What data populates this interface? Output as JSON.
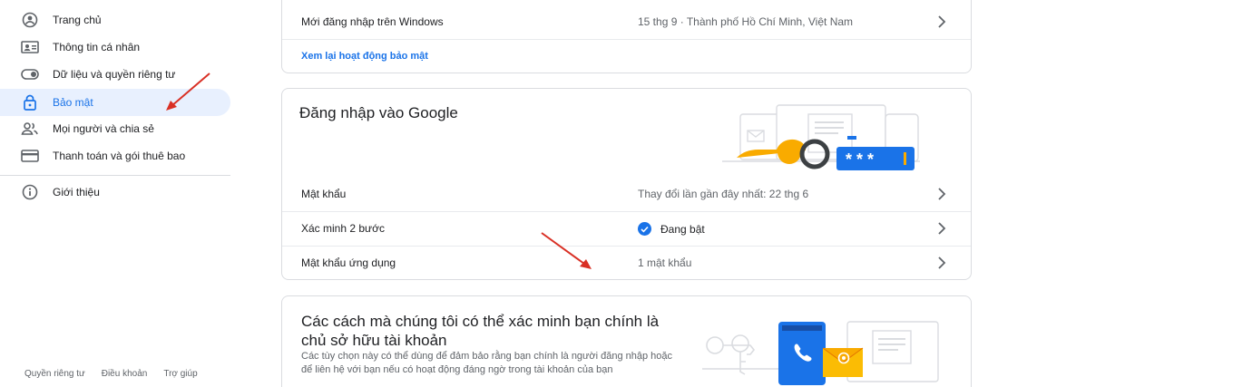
{
  "sidebar": {
    "items": [
      {
        "label": "Trang chủ",
        "icon": "home-icon"
      },
      {
        "label": "Thông tin cá nhân",
        "icon": "id-card-icon"
      },
      {
        "label": "Dữ liệu và quyền riêng tư",
        "icon": "toggle-icon"
      },
      {
        "label": "Bảo mật",
        "icon": "lock-icon",
        "active": true
      },
      {
        "label": "Mọi người và chia sẻ",
        "icon": "people-icon"
      },
      {
        "label": "Thanh toán và gói thuê bao",
        "icon": "credit-card-icon"
      },
      {
        "label": "Giới thiệu",
        "icon": "info-icon"
      }
    ],
    "footer": {
      "privacy": "Quyền riêng tư",
      "terms": "Điều khoản",
      "help": "Trợ giúp"
    }
  },
  "recent_activity": {
    "row_label": "Mới đăng nhập trên Windows",
    "row_value": "15 thg 9 · Thành phố Hồ Chí Minh, Việt Nam",
    "review_link": "Xem lại hoạt động bảo mật"
  },
  "signin": {
    "title": "Đăng nhập vào Google",
    "rows": [
      {
        "label": "Mật khẩu",
        "value": "Thay đổi lần gần đây nhất: 22 thg 6"
      },
      {
        "label": "Xác minh 2 bước",
        "value": "Đang bật",
        "status": "on"
      },
      {
        "label": "Mật khẩu ứng dụng",
        "value": "1 mật khẩu"
      }
    ],
    "password_mask": "* * *"
  },
  "verify": {
    "title": "Các cách mà chúng tôi có thể xác minh bạn chính là chủ sở hữu tài khoản",
    "description": "Các tùy chọn này có thể dùng để đảm bảo rằng bạn chính là người đăng nhập hoặc để liên hệ với bạn nếu có hoạt động đáng ngờ trong tài khoản của bạn"
  },
  "colors": {
    "accent": "#1a73e8",
    "active_bg": "#e8f0fe",
    "annotation_arrow": "#d93025",
    "key_yellow": "#f9ab00",
    "password_blue": "#1a73e8"
  }
}
